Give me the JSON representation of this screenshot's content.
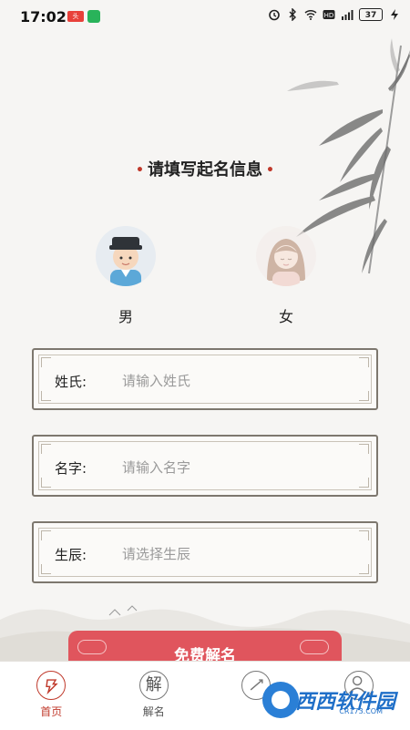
{
  "status_bar": {
    "time": "17:02",
    "battery": "37"
  },
  "form": {
    "title": "请填写起名信息",
    "gender_male": "男",
    "gender_female": "女",
    "surname_label": "姓氏:",
    "surname_placeholder": "请输入姓氏",
    "name_label": "名字:",
    "name_placeholder": "请输入名字",
    "birth_label": "生辰:",
    "birth_placeholder": "请选择生辰",
    "submit_label": "免费解名"
  },
  "bottom_nav": {
    "home": "首页",
    "interpret": "解名",
    "interpret_icon_char": "解"
  },
  "watermark": {
    "text": "西西软件园",
    "sub": "CR173.COM"
  },
  "colors": {
    "accent": "#c0392b",
    "button": "#e0555d"
  }
}
